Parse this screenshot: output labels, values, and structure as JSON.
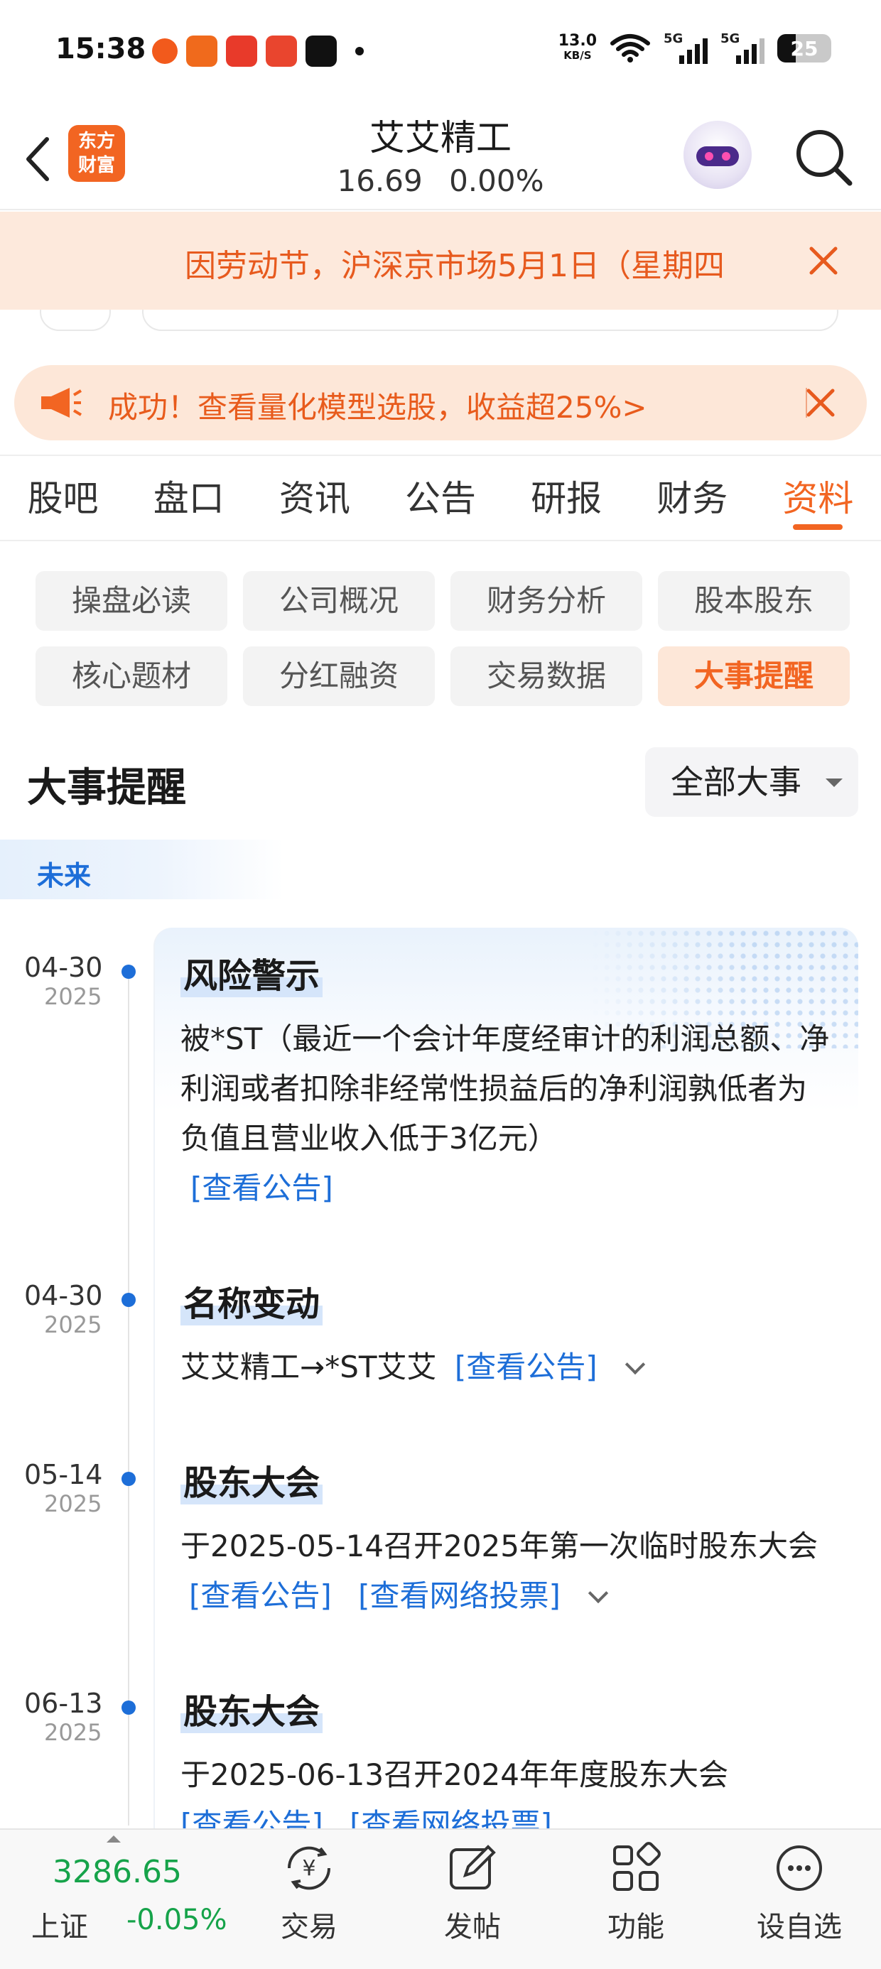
{
  "status": {
    "time": "15:38",
    "net_speed": "13.0",
    "net_speed_unit": "KB/S",
    "signal1": "5G",
    "signal2": "5G",
    "battery": "25"
  },
  "header": {
    "logo_text": "东方\n财富",
    "stock_name": "艾艾精工",
    "price": "16.69",
    "change_pct": "0.00%"
  },
  "holiday_notice": "因劳动节，沪深京市场5月1日（星期四",
  "promo": "成功！查看量化模型选股，收益超25%>",
  "tabs": [
    {
      "label": "股吧"
    },
    {
      "label": "盘口"
    },
    {
      "label": "资讯"
    },
    {
      "label": "公告"
    },
    {
      "label": "研报"
    },
    {
      "label": "财务"
    },
    {
      "label": "资料"
    }
  ],
  "chips": [
    {
      "label": "操盘必读"
    },
    {
      "label": "公司概况"
    },
    {
      "label": "财务分析"
    },
    {
      "label": "股本股东"
    },
    {
      "label": "核心题材"
    },
    {
      "label": "分红融资"
    },
    {
      "label": "交易数据"
    },
    {
      "label": "大事提醒"
    }
  ],
  "section": {
    "title": "大事提醒",
    "filter": "全部大事",
    "period": "未来"
  },
  "events": [
    {
      "date": "04-30",
      "year": "2025",
      "title": "风险警示",
      "text": "被*ST（最近一个会计年度经审计的利润总额、净利润或者扣除非经常性损益后的净利润孰低者为负值且营业收入低于3亿元）",
      "link1": "[查看公告]"
    },
    {
      "date": "04-30",
      "year": "2025",
      "title": "名称变动",
      "text": "艾艾精工→*ST艾艾",
      "link1": "[查看公告]"
    },
    {
      "date": "05-14",
      "year": "2025",
      "title": "股东大会",
      "text": "于2025-05-14召开2025年第一次临时股东大会",
      "link1": "[查看公告]",
      "link2": "[查看网络投票]"
    },
    {
      "date": "06-13",
      "year": "2025",
      "title": "股东大会",
      "text": "于2025-06-13召开2024年年度股东大会",
      "link1": "[查看公告]",
      "link2": "[查看网络投票]"
    }
  ],
  "bottom": {
    "index_value": "3286.65",
    "index_name": "上证",
    "index_change": "-0.05%",
    "nav": [
      {
        "label": "交易"
      },
      {
        "label": "发帖"
      },
      {
        "label": "功能"
      },
      {
        "label": "设自选"
      }
    ]
  },
  "colors": {
    "accent": "#f26522",
    "link": "#1d6ed8",
    "up_green": "#16a34a"
  }
}
